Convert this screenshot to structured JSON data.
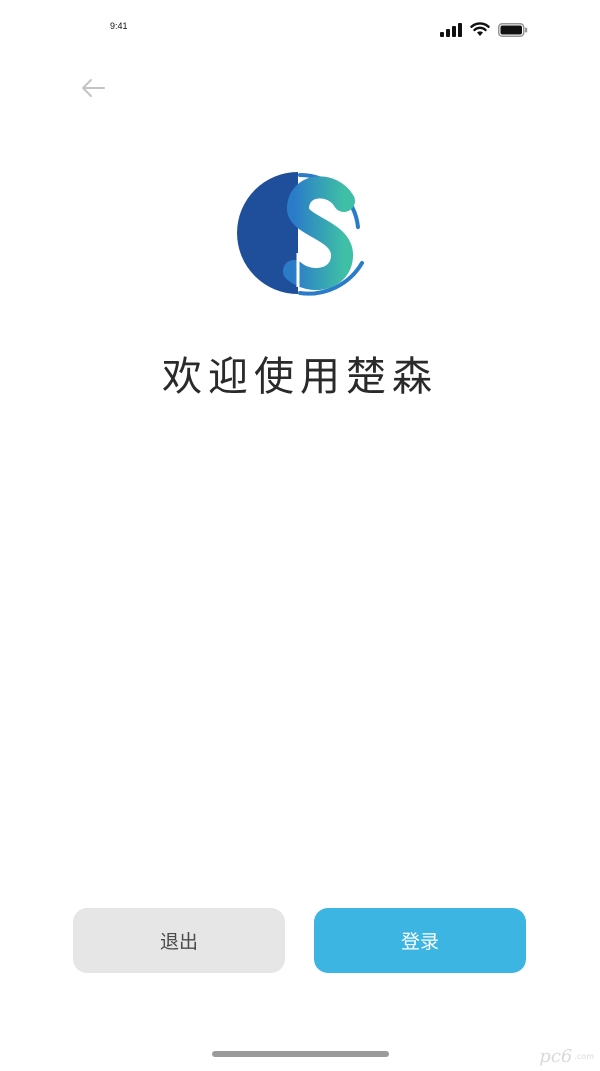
{
  "status_bar": {
    "time": "9:41",
    "icons": [
      "signal-icon",
      "wifi-icon",
      "battery-icon"
    ]
  },
  "nav": {
    "back_icon": "arrow-left-icon"
  },
  "logo": {
    "icon": "chusen-logo-icon",
    "colors": {
      "dark_blue": "#1f4f9a",
      "blue": "#2b7cc8",
      "teal": "#3fbfa6",
      "cyan": "#3db5e2"
    }
  },
  "welcome": {
    "title": "欢迎使用楚森"
  },
  "actions": {
    "exit_label": "退出",
    "login_label": "登录"
  },
  "colors": {
    "accent": "#3db5e2",
    "secondary_button": "#e6e6e6",
    "text": "#2a2a2a"
  },
  "watermark": {
    "text": "pc6",
    "sub": ".com"
  }
}
